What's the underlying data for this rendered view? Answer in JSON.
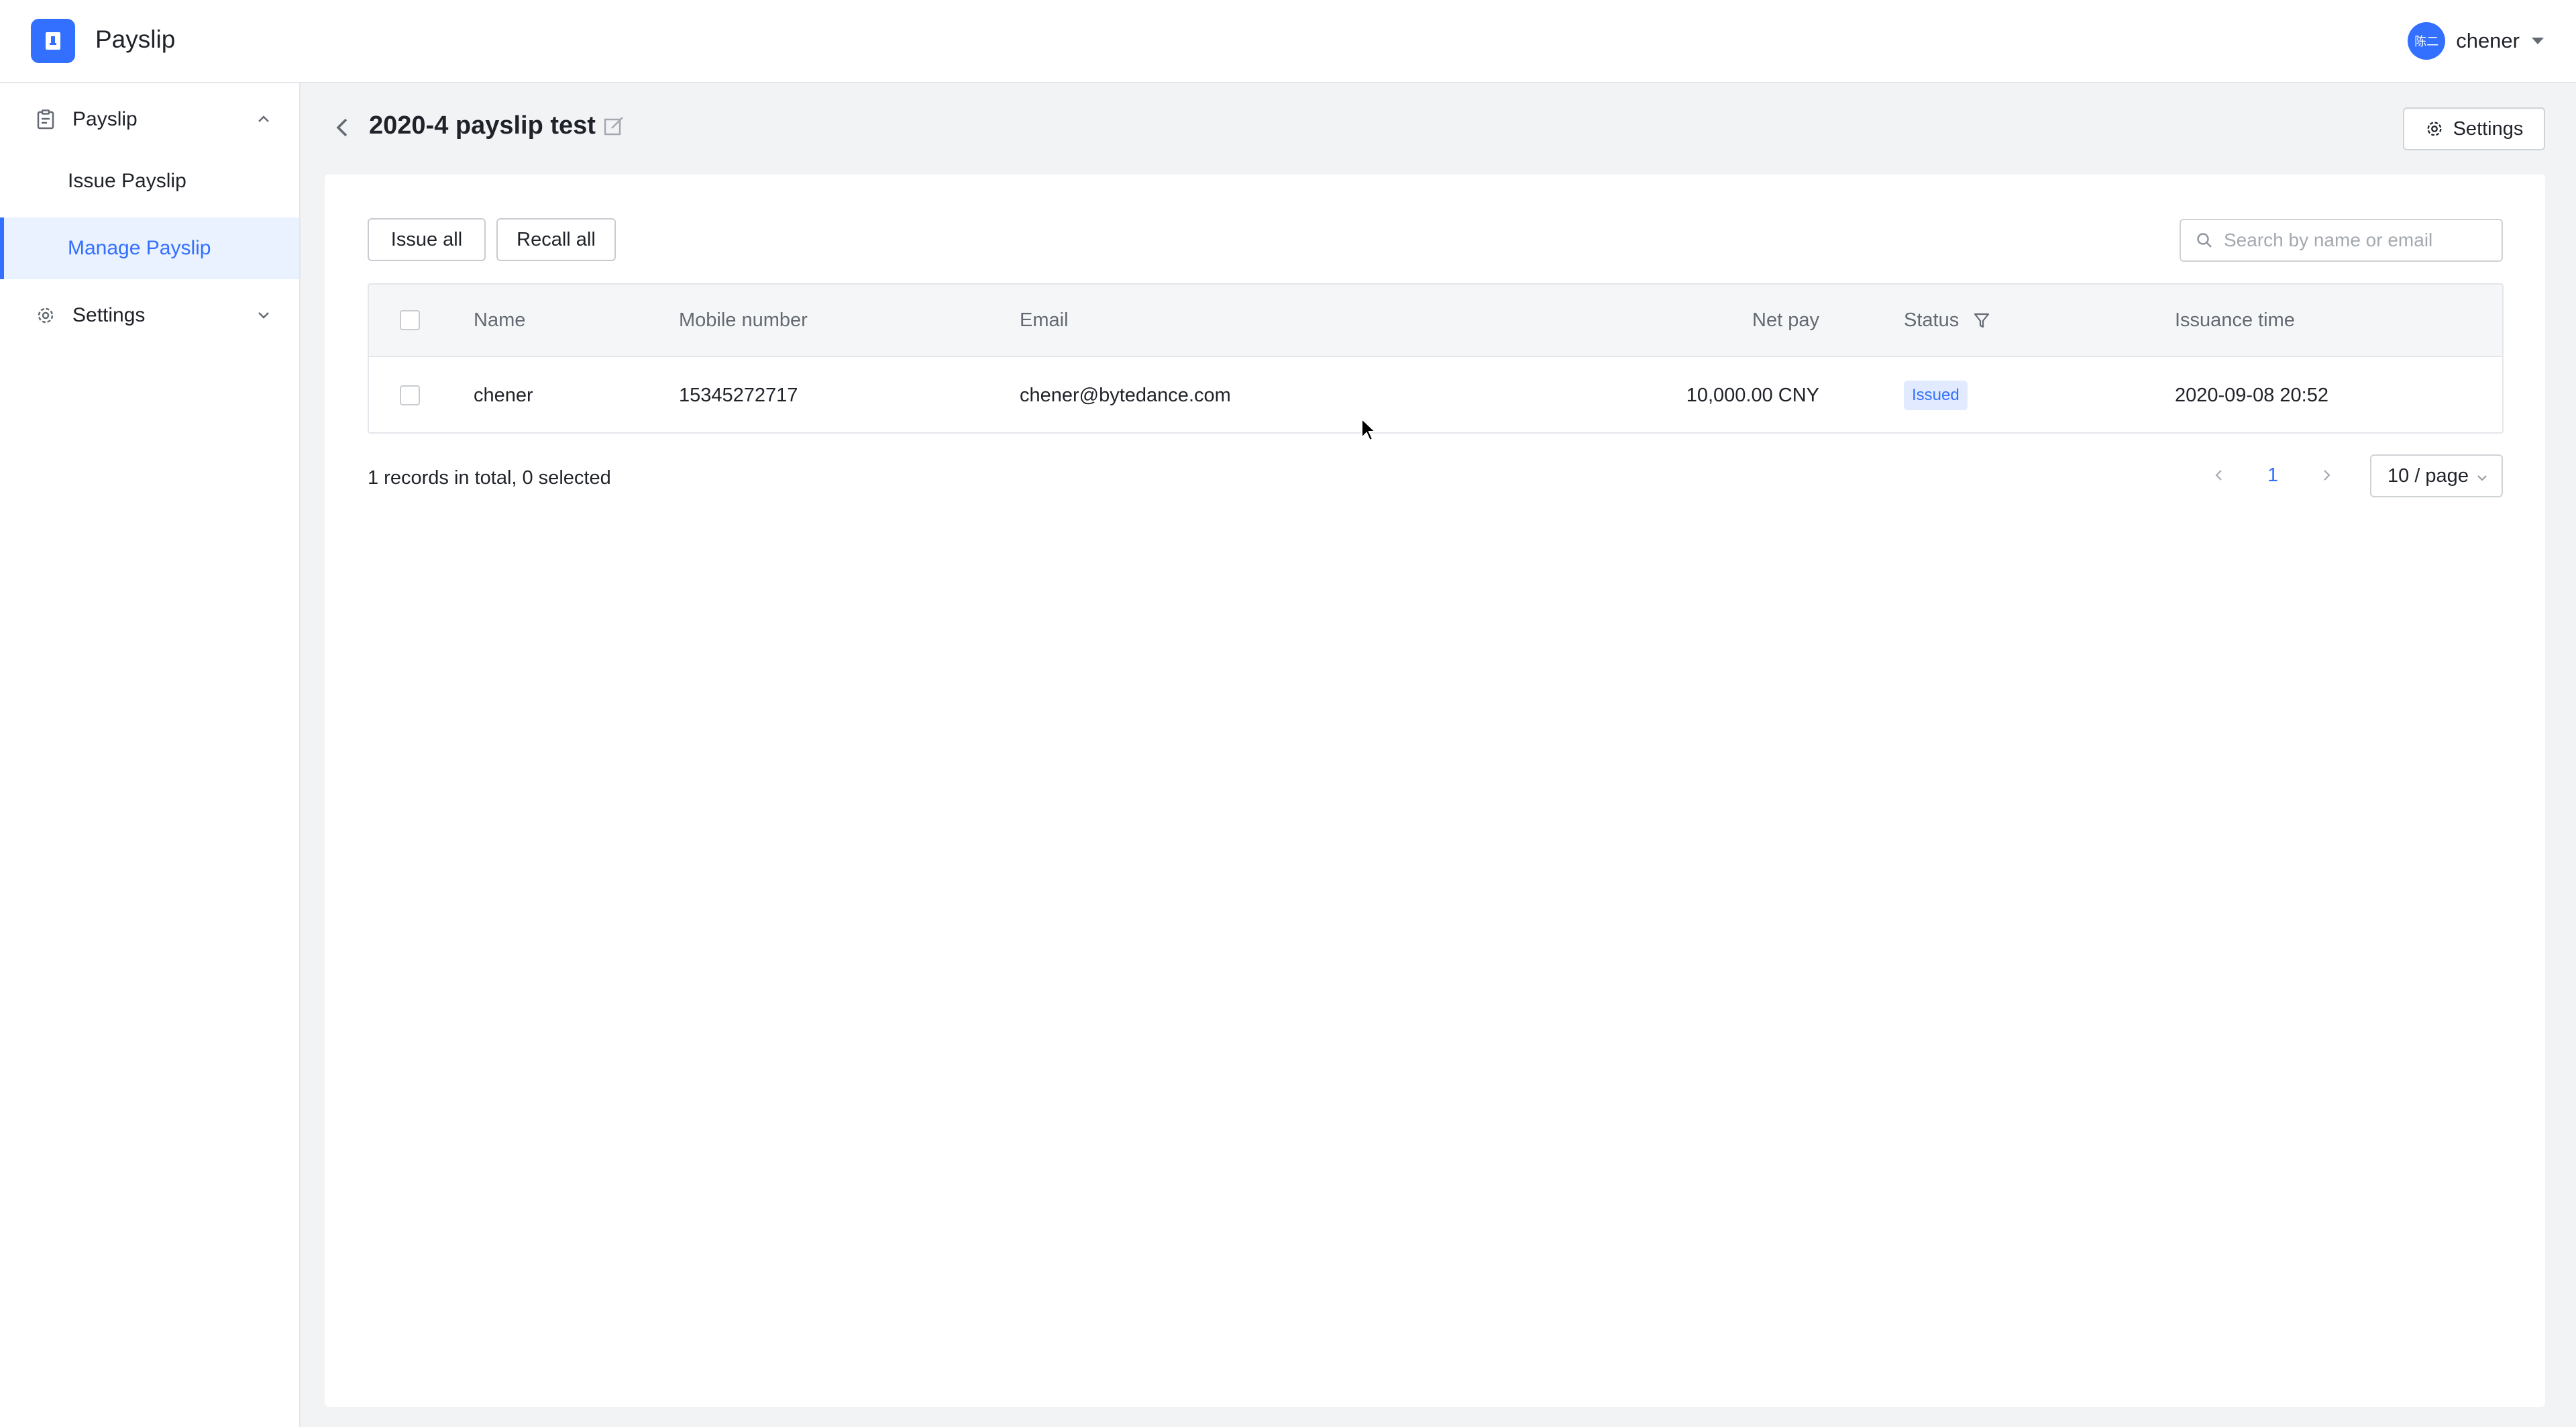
{
  "app": {
    "title": "Payslip",
    "logo_icon": "payslip-logo-icon",
    "accent": "#3370ff"
  },
  "user": {
    "avatar_text": "陈二",
    "name": "chener"
  },
  "sidebar": {
    "groups": [
      {
        "label": "Payslip",
        "icon": "clipboard-icon",
        "expanded": true,
        "items": [
          {
            "label": "Issue Payslip"
          },
          {
            "label": "Manage Payslip",
            "active": true
          }
        ]
      },
      {
        "label": "Settings",
        "icon": "gear-icon",
        "expanded": false
      }
    ]
  },
  "page": {
    "title": "2020-4 payslip test",
    "settings_label": "Settings"
  },
  "toolbar": {
    "issue_all": "Issue all",
    "recall_all": "Recall all",
    "search_placeholder": "Search by name or email"
  },
  "table": {
    "columns": [
      "Name",
      "Mobile number",
      "Email",
      "Net pay",
      "Status",
      "Issuance time"
    ],
    "rows": [
      {
        "name": "chener",
        "mobile": "15345272717",
        "email": "chener@bytedance.com",
        "net_pay": "10,000.00 CNY",
        "status": "Issued",
        "issuance_time": "2020-09-08 20:52"
      }
    ]
  },
  "footer": {
    "summary": "1 records in total, 0 selected",
    "current_page": "1",
    "page_size": "10 / page"
  }
}
